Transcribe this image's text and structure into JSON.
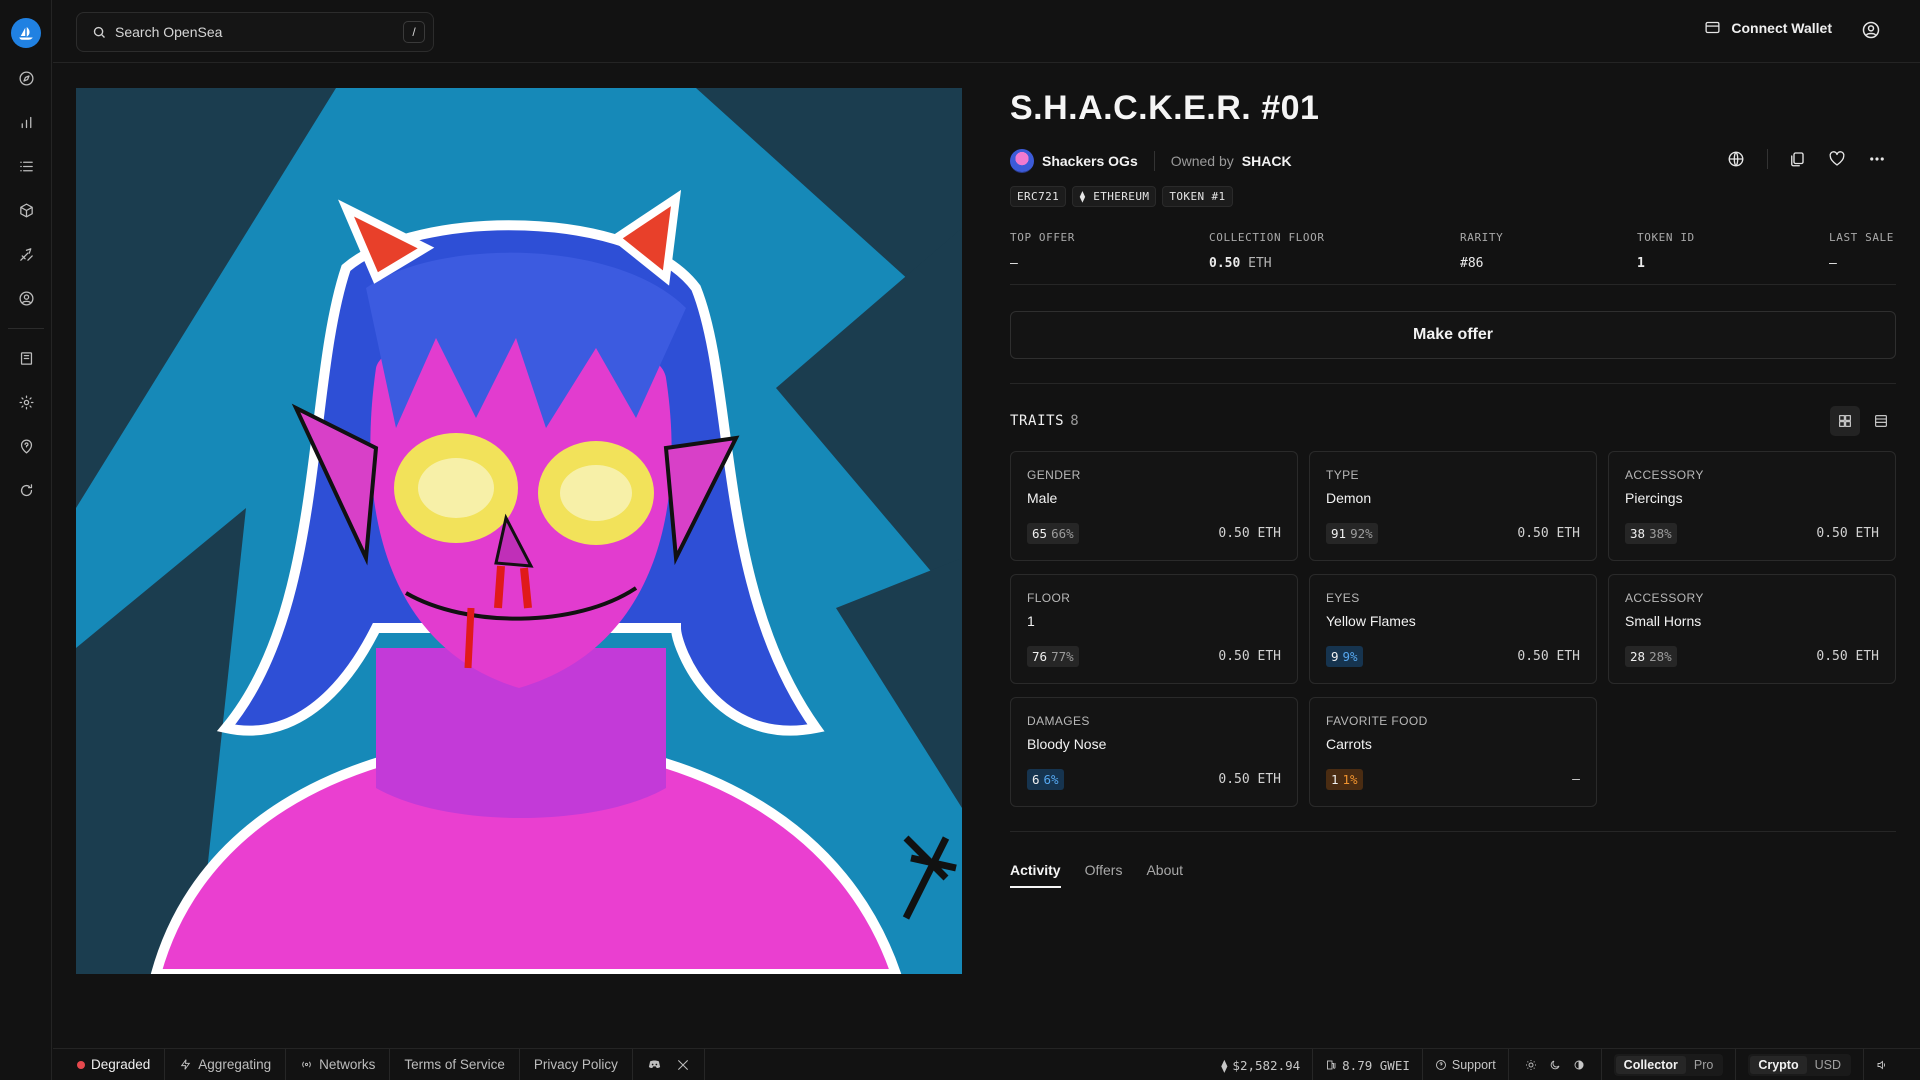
{
  "search": {
    "placeholder": "Search OpenSea",
    "shortcut": "/"
  },
  "header": {
    "connect_label": "Connect Wallet"
  },
  "nft": {
    "title": "S.H.A.C.K.E.R. #01",
    "collection": "Shackers OGs",
    "owned_by_label": "Owned by",
    "owner": "SHACK",
    "chips": [
      "ERC721",
      "ETHEREUM",
      "TOKEN #1"
    ]
  },
  "stats": {
    "top_offer": {
      "label": "TOP OFFER",
      "value": "–"
    },
    "collection_floor": {
      "label": "COLLECTION FLOOR",
      "value": "0.50",
      "unit": "ETH"
    },
    "rarity": {
      "label": "RARITY",
      "value": "#86"
    },
    "token_id": {
      "label": "TOKEN ID",
      "value": "1"
    },
    "last_sale": {
      "label": "LAST SALE",
      "value": "–"
    }
  },
  "make_offer_label": "Make offer",
  "traits": {
    "title": "TRAITS",
    "count": "8",
    "items": [
      {
        "type": "GENDER",
        "value": "Male",
        "count": "65",
        "pct": "66%",
        "price": "0.50 ETH",
        "tone": ""
      },
      {
        "type": "TYPE",
        "value": "Demon",
        "count": "91",
        "pct": "92%",
        "price": "0.50 ETH",
        "tone": ""
      },
      {
        "type": "ACCESSORY",
        "value": "Piercings",
        "count": "38",
        "pct": "38%",
        "price": "0.50 ETH",
        "tone": ""
      },
      {
        "type": "FLOOR",
        "value": "1",
        "count": "76",
        "pct": "77%",
        "price": "0.50 ETH",
        "tone": ""
      },
      {
        "type": "EYES",
        "value": "Yellow Flames",
        "count": "9",
        "pct": "9%",
        "price": "0.50 ETH",
        "tone": "blue"
      },
      {
        "type": "ACCESSORY",
        "value": "Small Horns",
        "count": "28",
        "pct": "28%",
        "price": "0.50 ETH",
        "tone": ""
      },
      {
        "type": "DAMAGES",
        "value": "Bloody Nose",
        "count": "6",
        "pct": "6%",
        "price": "0.50 ETH",
        "tone": "blue"
      },
      {
        "type": "FAVORITE FOOD",
        "value": "Carrots",
        "count": "1",
        "pct": "1%",
        "price": "–",
        "tone": "orange"
      }
    ]
  },
  "tabs": [
    "Activity",
    "Offers",
    "About"
  ],
  "footer": {
    "status": "Degraded",
    "aggregating": "Aggregating",
    "networks": "Networks",
    "terms": "Terms of Service",
    "privacy": "Privacy Policy",
    "eth_price": "$2,582.94",
    "gas": "8.79 GWEI",
    "support": "Support",
    "mode_collector": "Collector",
    "mode_pro": "Pro",
    "currency_crypto": "Crypto",
    "currency_usd": "USD"
  },
  "icons": {
    "sidebar": [
      "compass-icon",
      "chart-icon",
      "list-icon",
      "cube-icon",
      "brush-icon",
      "user-circle-icon",
      "book-icon",
      "gear-icon",
      "help-icon",
      "refresh-icon"
    ]
  },
  "colors": {
    "brand": "#2081e2",
    "status_red": "#e5484d",
    "rarity_blue": "#56a7ef",
    "rarity_orange": "#f0932f"
  }
}
